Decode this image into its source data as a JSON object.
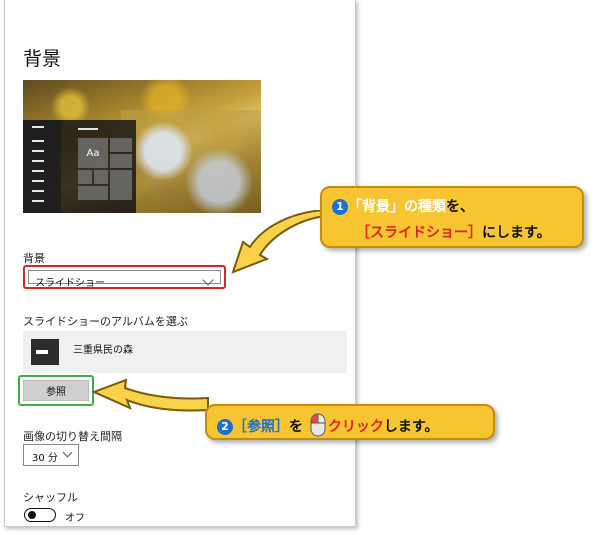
{
  "page": {
    "title": "背景"
  },
  "preview": {
    "tile_label": "Aa"
  },
  "background_section": {
    "label": "背景",
    "selected": "スライドショー"
  },
  "album_section": {
    "label": "スライドショーのアルバムを選ぶ",
    "album_name": "三重県民の森",
    "browse_button": "参照"
  },
  "interval_section": {
    "label": "画像の切り替え間隔",
    "selected": "30 分"
  },
  "shuffle_section": {
    "label": "シャッフル",
    "state": "オフ"
  },
  "callout1": {
    "num": "1",
    "line1_part1": "「背景」の種類",
    "line1_part2": "を、",
    "line2_part1": "［スライドショー］",
    "line2_part2": "にします。"
  },
  "callout2": {
    "num": "2",
    "part1": "［参照］",
    "part2": "を",
    "part3": "クリック",
    "part4": "します。"
  },
  "colors": {
    "highlight_red": "#cf2a2a",
    "highlight_green": "#3fae49",
    "callout_fill": "#f7c531",
    "callout_text_blue": "#1d6fd0",
    "callout_text_red": "#e02020"
  }
}
